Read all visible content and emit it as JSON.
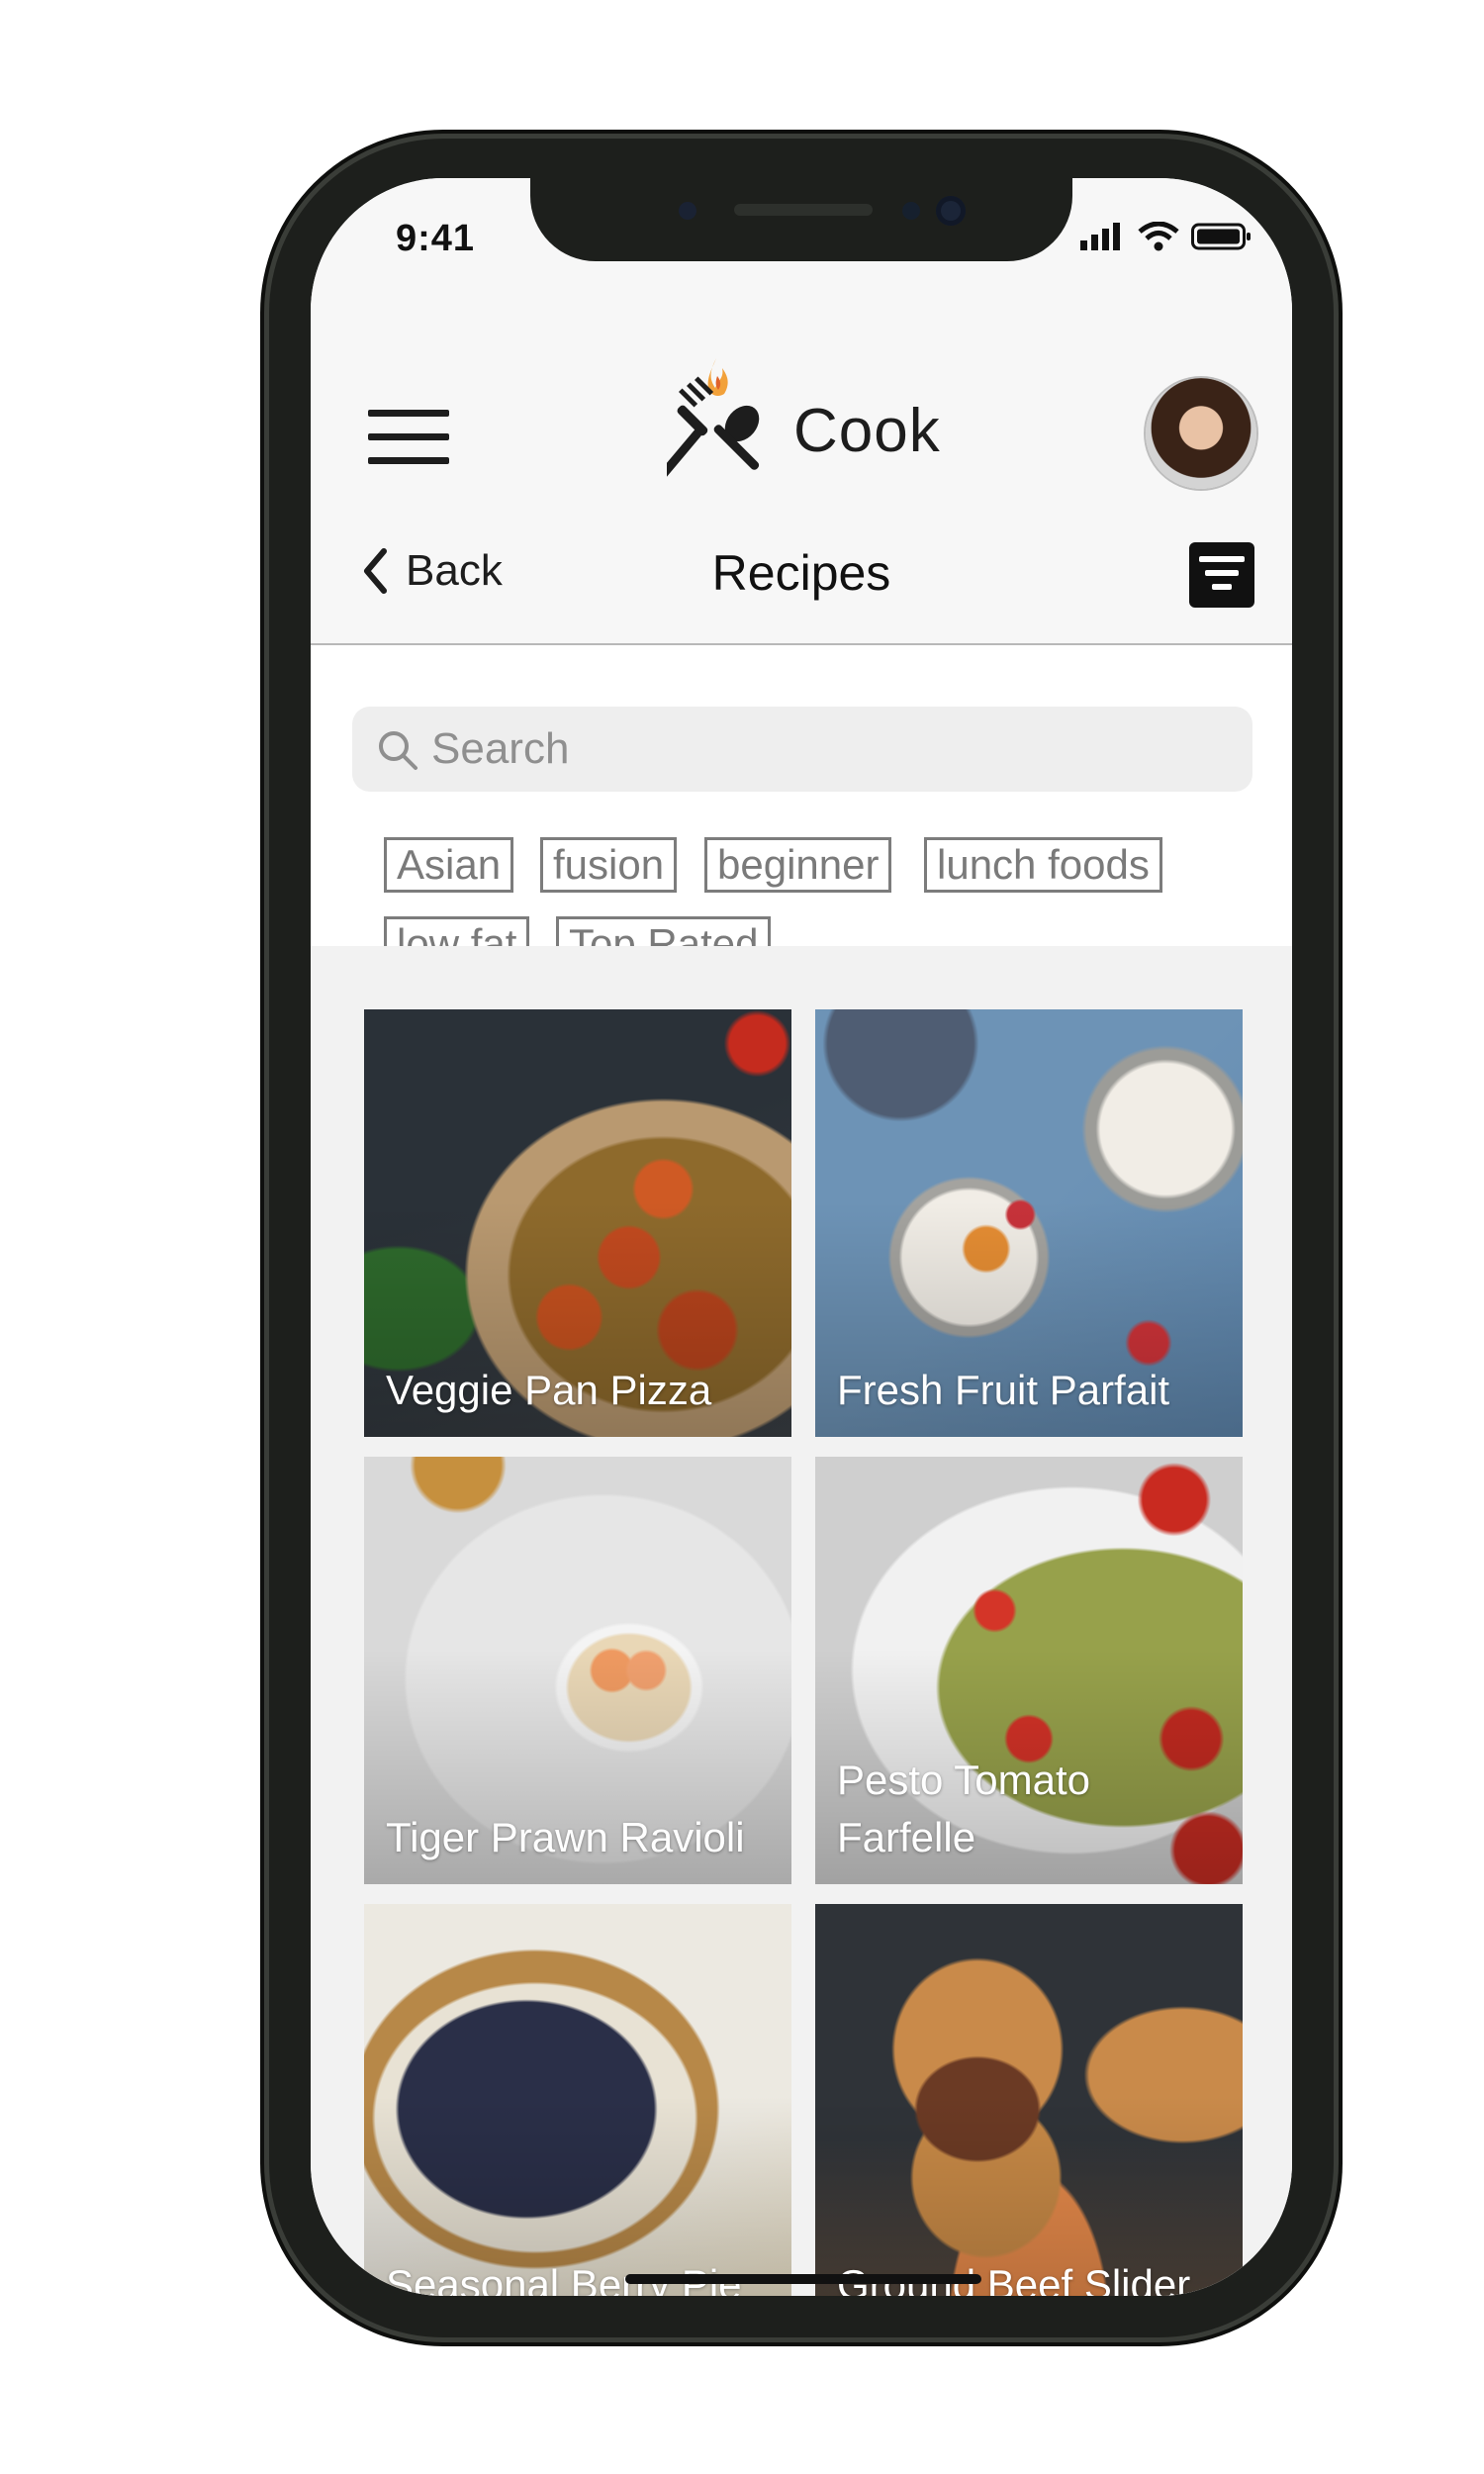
{
  "status_bar": {
    "time": "9:41"
  },
  "header": {
    "app_name": "Cook",
    "menu_icon": "hamburger-menu-icon",
    "logo_icon": "fork-spoon-flame-icon",
    "avatar": "user-avatar"
  },
  "nav": {
    "back_label": "Back",
    "title": "Recipes",
    "filter_icon": "filter-icon"
  },
  "search": {
    "placeholder": "Search"
  },
  "tags": [
    "Asian",
    "fusion",
    "beginner",
    "lunch foods",
    "low fat",
    "Top Rated"
  ],
  "recipes": [
    {
      "title": "Veggie Pan Pizza"
    },
    {
      "title": "Fresh Fruit Parfait"
    },
    {
      "title": "Tiger Prawn Ravioli"
    },
    {
      "title": "Pesto Tomato Farfelle"
    },
    {
      "title": "Seasonal Berry Pie"
    },
    {
      "title": "Ground Beef Slider"
    }
  ],
  "colors": {
    "accent_flame": "#f2a13a",
    "header_bg": "#f7f7f7",
    "grid_bg": "#f2f2f2",
    "tag_border": "#7c7c7c"
  }
}
